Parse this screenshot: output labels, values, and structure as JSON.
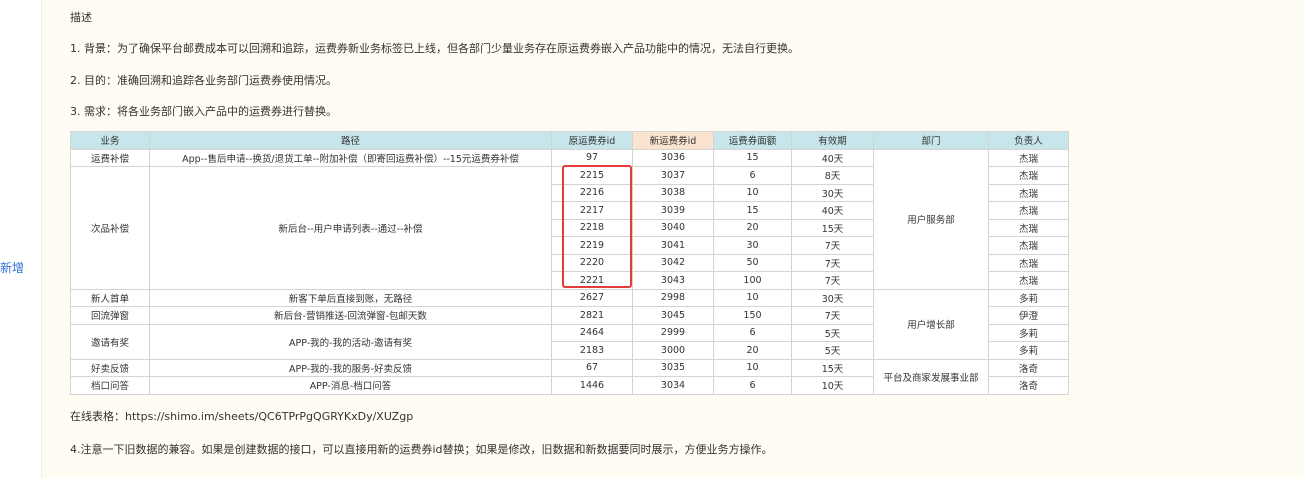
{
  "sidebar": {
    "new_link": "新增"
  },
  "content": {
    "title": "描述",
    "item1": "1. 背景：为了确保平台邮费成本可以回溯和追踪，运费券新业务标签已上线，但各部门少量业务存在原运费券嵌入产品功能中的情况，无法自行更换。",
    "item2": "2. 目的：准确回溯和追踪各业务部门运费券使用情况。",
    "item3": "3. 需求：将各业务部门嵌入产品中的运费券进行替换。",
    "online_link": "在线表格：https://shimo.im/sheets/QC6TPrPgQGRYKxDy/XUZgp",
    "item4": "4.注意一下旧数据的兼容。如果是创建数据的接口，可以直接用新的运费券id替换；如果是修改，旧数据和新数据要同时展示，方便业务方操作。"
  },
  "table": {
    "headers": [
      "业务",
      "路径",
      "原运费券id",
      "新运费券id",
      "运费券面额",
      "有效期",
      "部门",
      "负责人"
    ],
    "highlight_header": "新运费券id",
    "groups": {
      "g1": {
        "business": "运费补偿",
        "path": "App--售后申请--换货/退货工单--附加补偿（即寄回运费补偿）--15元运费券补偿"
      },
      "g2": {
        "business": "次品补偿",
        "path": "新后台--用户申请列表--通过--补偿"
      },
      "g3": {
        "business": "新人首单",
        "path": "新客下单后直接到账，无路径"
      },
      "g4": {
        "business": "回流弹窗",
        "path": "新后台-营销推送-回流弹窗-包邮天数"
      },
      "g5": {
        "business": "邀请有奖",
        "path": "APP-我的-我的活动-邀请有奖"
      },
      "g6": {
        "business": "好卖反馈",
        "path": "APP-我的-我的服务-好卖反馈"
      },
      "g7": {
        "business": "档口问答",
        "path": "APP-消息-档口问答"
      }
    },
    "departments": {
      "d1": "用户服务部",
      "d2": "用户增长部",
      "d3": "平台及商家发展事业部"
    },
    "rows": [
      {
        "old_id": "97",
        "new_id": "3036",
        "amount": "15",
        "validity": "40天",
        "owner": "杰瑞"
      },
      {
        "old_id": "2215",
        "new_id": "3037",
        "amount": "6",
        "validity": "8天",
        "owner": "杰瑞"
      },
      {
        "old_id": "2216",
        "new_id": "3038",
        "amount": "10",
        "validity": "30天",
        "owner": "杰瑞"
      },
      {
        "old_id": "2217",
        "new_id": "3039",
        "amount": "15",
        "validity": "40天",
        "owner": "杰瑞"
      },
      {
        "old_id": "2218",
        "new_id": "3040",
        "amount": "20",
        "validity": "15天",
        "owner": "杰瑞"
      },
      {
        "old_id": "2219",
        "new_id": "3041",
        "amount": "30",
        "validity": "7天",
        "owner": "杰瑞"
      },
      {
        "old_id": "2220",
        "new_id": "3042",
        "amount": "50",
        "validity": "7天",
        "owner": "杰瑞"
      },
      {
        "old_id": "2221",
        "new_id": "3043",
        "amount": "100",
        "validity": "7天",
        "owner": "杰瑞"
      },
      {
        "old_id": "2627",
        "new_id": "2998",
        "amount": "10",
        "validity": "30天",
        "owner": "多莉"
      },
      {
        "old_id": "2821",
        "new_id": "3045",
        "amount": "150",
        "validity": "7天",
        "owner": "伊澄"
      },
      {
        "old_id": "2464",
        "new_id": "2999",
        "amount": "6",
        "validity": "5天",
        "owner": "多莉"
      },
      {
        "old_id": "2183",
        "new_id": "3000",
        "amount": "20",
        "validity": "5天",
        "owner": "多莉"
      },
      {
        "old_id": "67",
        "new_id": "3035",
        "amount": "10",
        "validity": "15天",
        "owner": "洛奇"
      },
      {
        "old_id": "1446",
        "new_id": "3034",
        "amount": "6",
        "validity": "10天",
        "owner": "洛奇"
      }
    ]
  },
  "colors": {
    "panel_bg": "#fefcf3",
    "header_bg": "#c6e6ec",
    "highlight_header_bg": "#fbe4cf",
    "annotation_red": "#e53b3b",
    "link_blue": "#2f6fd6"
  }
}
